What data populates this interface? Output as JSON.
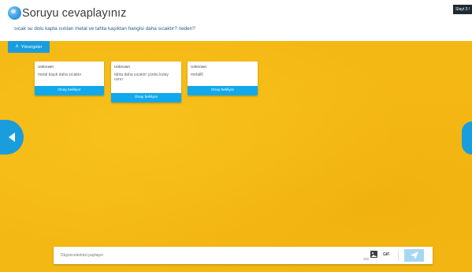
{
  "header": {
    "title": "Soruyu cevaplayınız",
    "question": "sıcak su dolu kapta ısıtılan metal ve tahta kaşıktan hangisi daha sıcaktır? neden?",
    "slide_badge": "Slayt 3 /"
  },
  "board": {
    "background_color": "#f4b814",
    "instructions_label": "Yönergeler"
  },
  "responses": [
    {
      "author": "Unknown",
      "text": "metal kaşık daha sıcaktır",
      "status": "Onay bekliyor"
    },
    {
      "author": "Unknown",
      "text": "tahta daha sıcaktır çünkü kolay ısınır",
      "status": "Onay bekliyor"
    },
    {
      "author": "Unknown",
      "text": "metallll",
      "status": "Onay bekliyor"
    }
  ],
  "composer": {
    "placeholder": "Düşüncelerinizi paylaşın",
    "char_count": "250",
    "gif_label": "GIF"
  },
  "icons": {
    "title": "globe-icon",
    "instructions": "chevron-up-icon",
    "nav_left": "caret-left-icon",
    "nav_right": "caret-right-icon",
    "image": "image-icon",
    "send": "paper-plane-icon"
  },
  "colors": {
    "accent": "#1a9ddc",
    "status_bar": "#12a9ec",
    "send_disabled": "#a7d8f3"
  }
}
